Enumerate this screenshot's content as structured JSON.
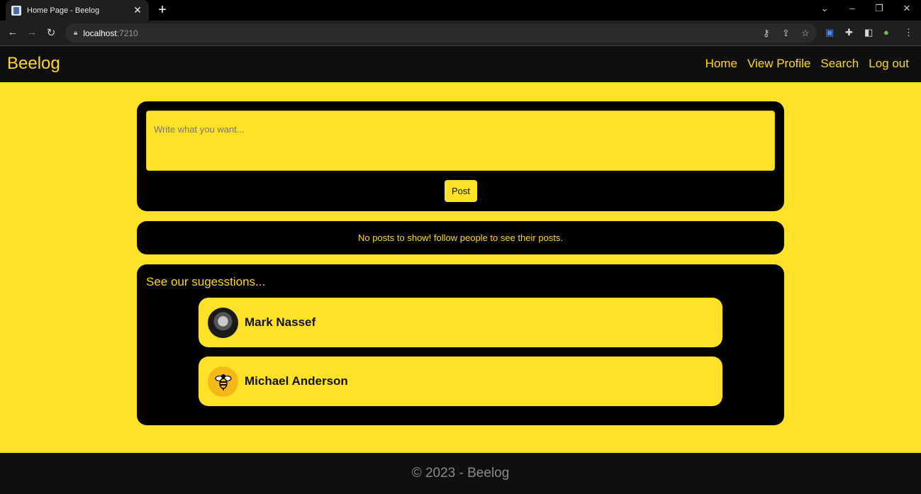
{
  "browser": {
    "tab_title": "Home Page - Beelog",
    "url_host": "localhost",
    "url_port": ":7210"
  },
  "navbar": {
    "brand": "Beelog",
    "links": [
      "Home",
      "View Profile",
      "Search",
      "Log out"
    ]
  },
  "composer": {
    "placeholder": "Write what you want...",
    "post_label": "Post"
  },
  "feed": {
    "empty_message": "No posts to show! follow people to see their posts."
  },
  "suggestions": {
    "title": "See our sugesstions...",
    "users": [
      {
        "name": "Mark Nassef",
        "avatar": "photo-avatar"
      },
      {
        "name": "Michael Anderson",
        "avatar": "bee-avatar"
      }
    ]
  },
  "footer": {
    "text": "© 2023 - Beelog"
  },
  "colors": {
    "accent": "#ffe228",
    "brand_text": "#ffd526",
    "dark": "#0f0f10"
  }
}
